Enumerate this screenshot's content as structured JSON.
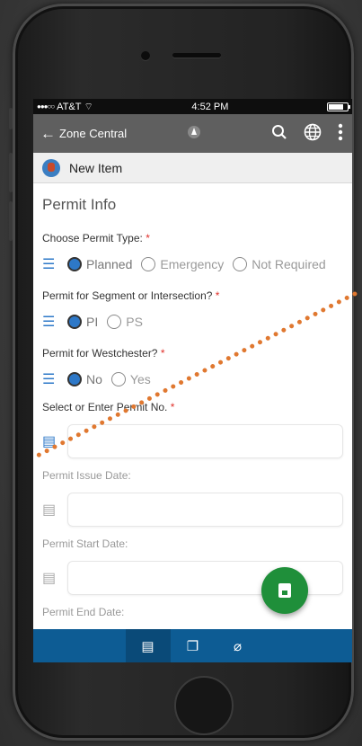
{
  "status_bar": {
    "carrier": "AT&T",
    "time": "4:52 PM"
  },
  "app_bar": {
    "back_label": "Zone Central"
  },
  "sub_bar": {
    "title": "New Item"
  },
  "form": {
    "section_title": "Permit Info",
    "permit_type": {
      "label": "Choose Permit Type:",
      "required_mark": "*",
      "options": [
        "Planned",
        "Emergency",
        "Not Required"
      ],
      "selected": "Planned"
    },
    "segment": {
      "label": "Permit for Segment or Intersection?",
      "required_mark": "*",
      "options": [
        "PI",
        "PS"
      ],
      "selected": "PI"
    },
    "westchester": {
      "label": "Permit for Westchester?",
      "required_mark": "*",
      "options": [
        "No",
        "Yes"
      ],
      "selected": "No"
    },
    "permit_no": {
      "label": "Select or Enter Permit No.",
      "required_mark": "*"
    },
    "issue_date": {
      "label": "Permit Issue Date:"
    },
    "start_date": {
      "label": "Permit Start Date:"
    },
    "end_date": {
      "label": "Permit End Date:"
    }
  },
  "colors": {
    "accent": "#2d78c8",
    "appbar": "#5f5f5f",
    "bottom_nav": "#0d5c94",
    "fab": "#1f8f3a",
    "required": "#e0302a",
    "annotation": "#e07830"
  }
}
